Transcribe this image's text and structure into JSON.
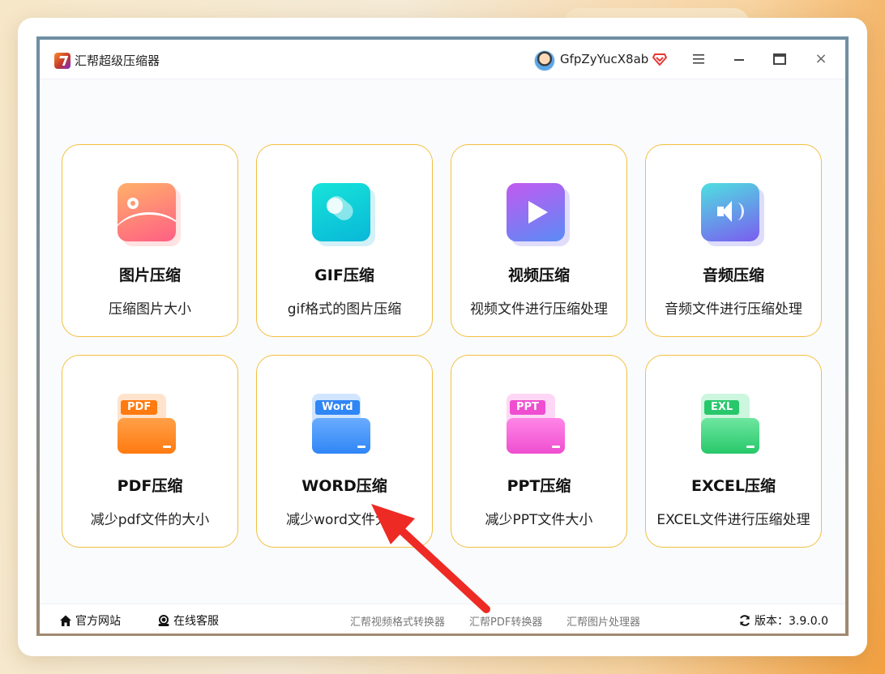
{
  "app": {
    "title": "汇帮超级压缩器",
    "username": "GfpZyYucX8ab"
  },
  "cards": [
    {
      "title": "图片压缩",
      "desc": "压缩图片大小",
      "icon": "image-icon"
    },
    {
      "title": "GIF压缩",
      "desc": "gif格式的图片压缩",
      "icon": "gif-icon"
    },
    {
      "title": "视频压缩",
      "desc": "视频文件进行压缩处理",
      "icon": "video-icon"
    },
    {
      "title": "音频压缩",
      "desc": "音频文件进行压缩处理",
      "icon": "audio-icon"
    },
    {
      "title": "PDF压缩",
      "desc": "减少pdf文件的大小",
      "icon": "pdf-folder-icon",
      "tag": "PDF"
    },
    {
      "title": "WORD压缩",
      "desc": "减少word文件大小",
      "icon": "word-folder-icon",
      "tag": "Word"
    },
    {
      "title": "PPT压缩",
      "desc": "减少PPT文件大小",
      "icon": "ppt-folder-icon",
      "tag": "PPT"
    },
    {
      "title": "EXCEL压缩",
      "desc": "EXCEL文件进行压缩处理",
      "icon": "excel-folder-icon",
      "tag": "EXL"
    }
  ],
  "footer": {
    "website": "官方网站",
    "support": "在线客服",
    "links": [
      "汇帮视频格式转换器",
      "汇帮PDF转换器",
      "汇帮图片处理器"
    ],
    "version": "版本：3.9.0.0"
  },
  "colors": {
    "card_border": "#f2c040",
    "annotation_arrow": "#ee2a24"
  }
}
